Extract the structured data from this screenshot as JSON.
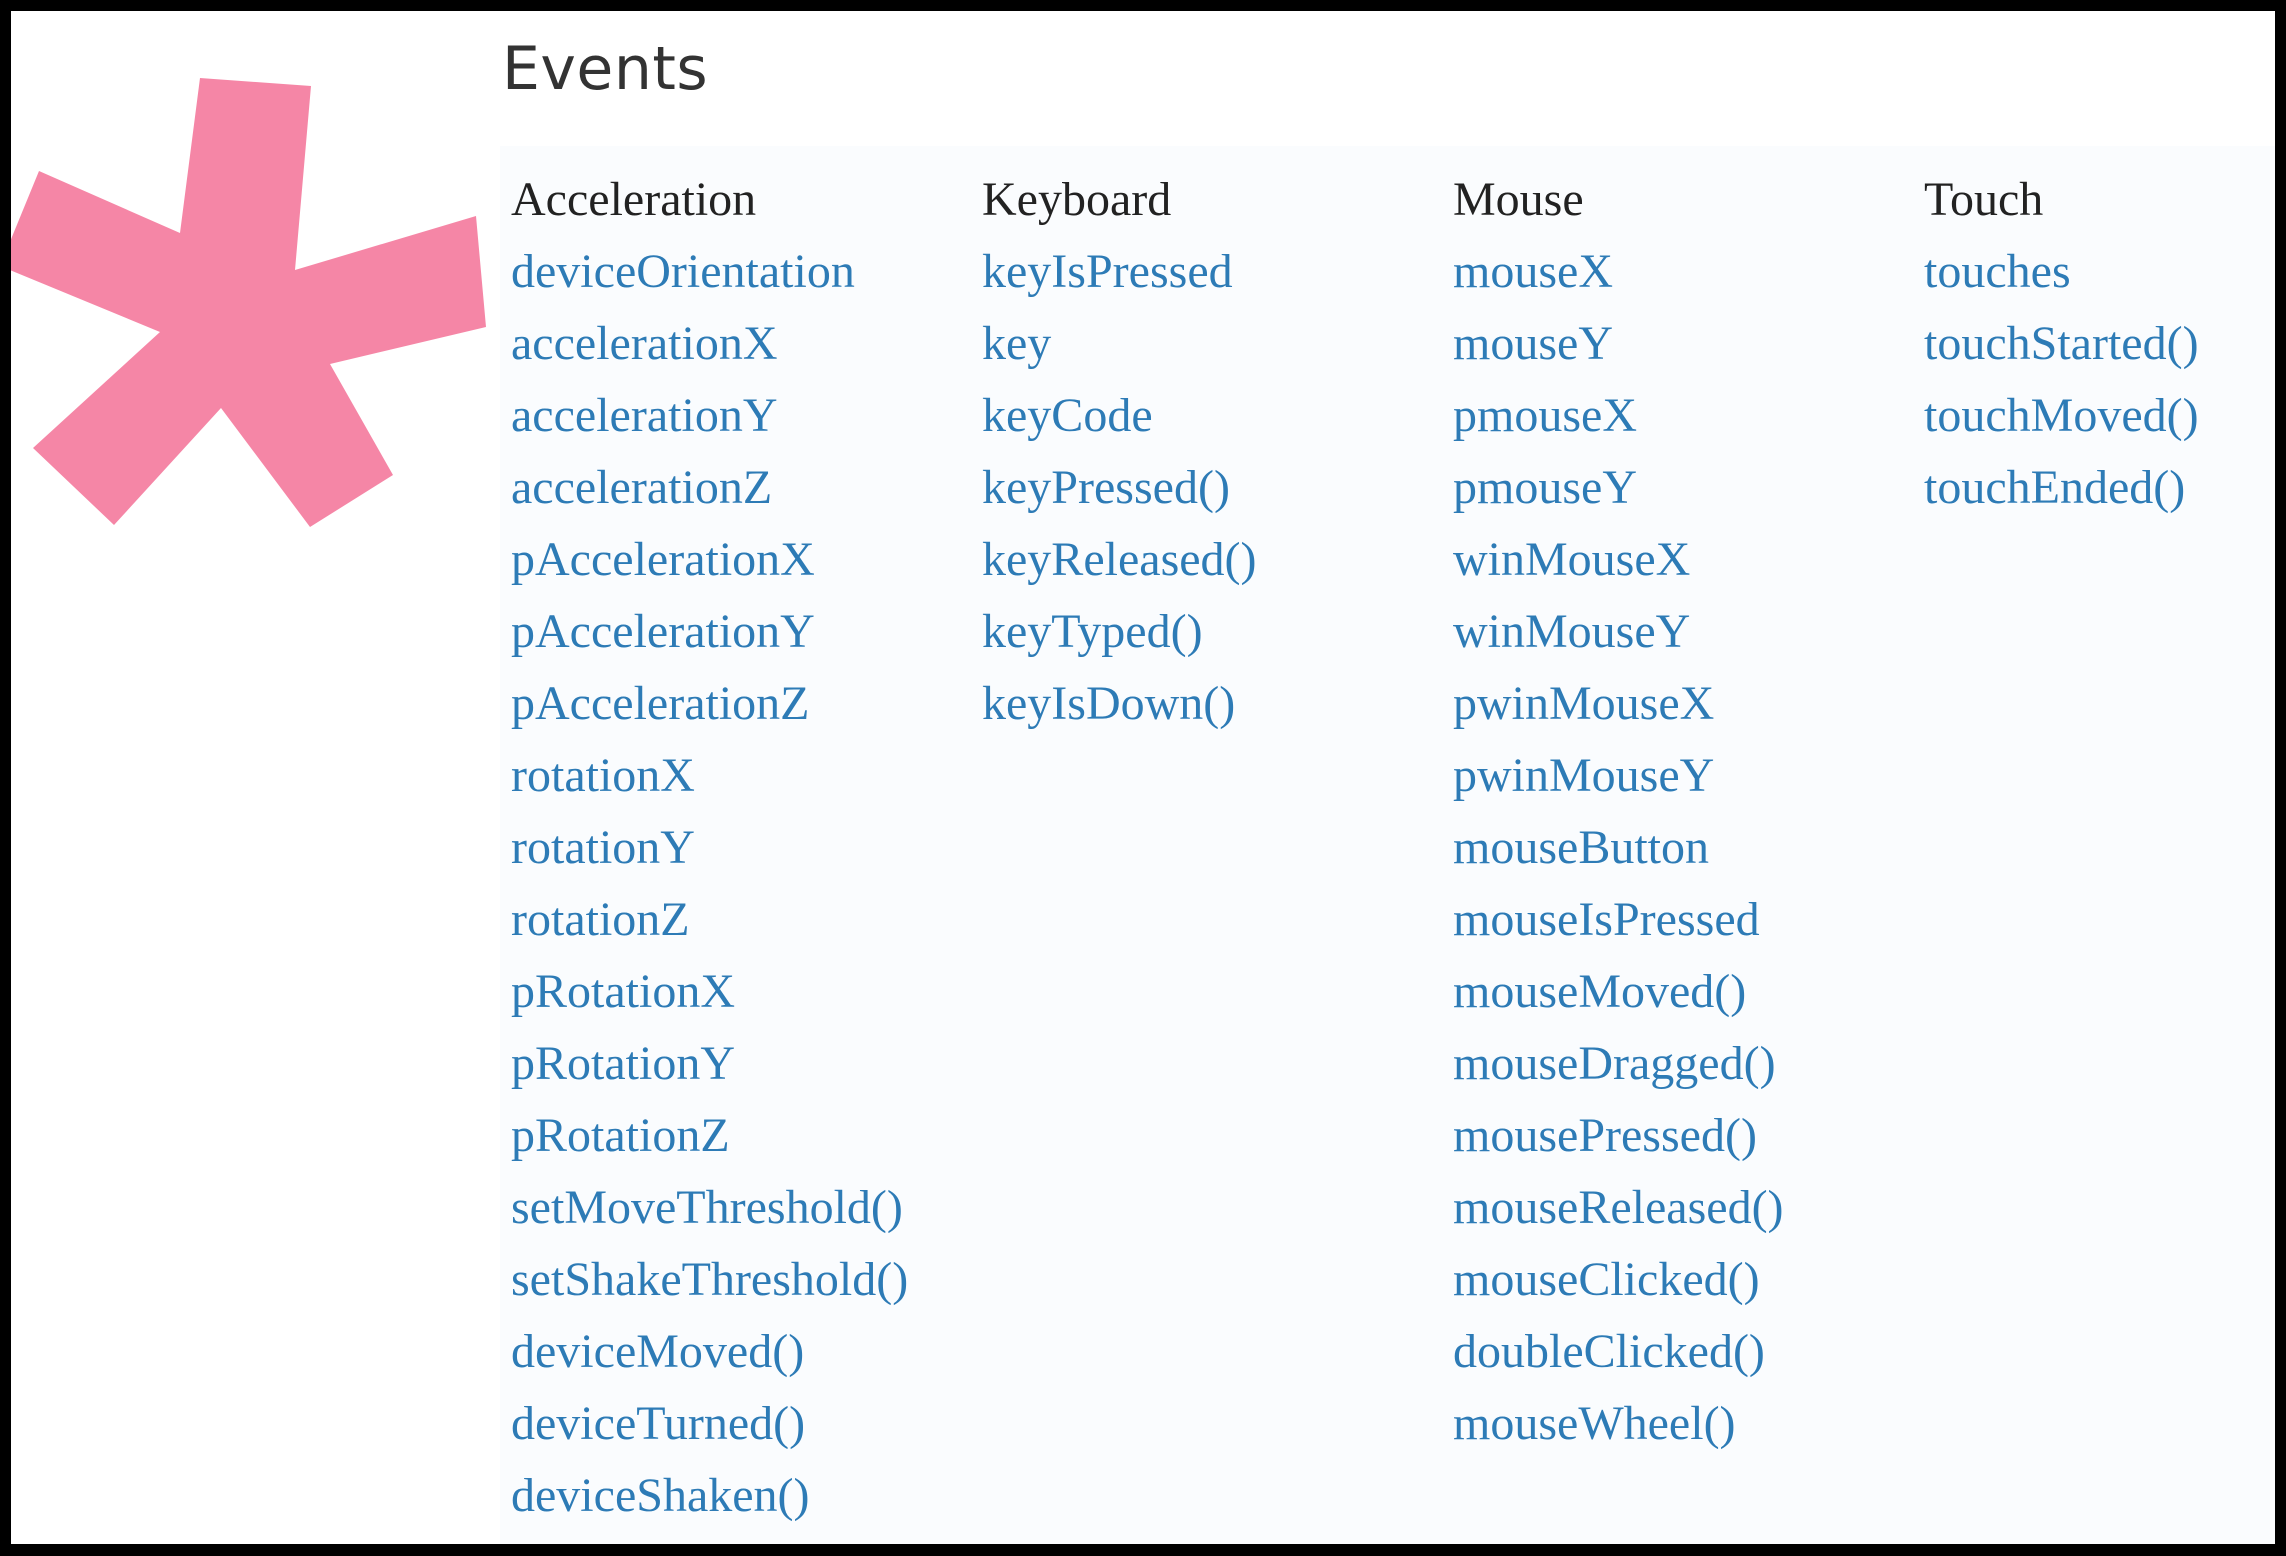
{
  "section": {
    "title": "Events"
  },
  "colors": {
    "accent_asterisk": "#ED225D",
    "link": "#2D7BB6",
    "heading": "#222222",
    "panel_background": "#FAFCFE"
  },
  "decoration": {
    "icon": "asterisk-icon"
  },
  "columns": [
    {
      "heading": "Acceleration",
      "items": [
        "deviceOrientation",
        "accelerationX",
        "accelerationY",
        "accelerationZ",
        "pAccelerationX",
        "pAccelerationY",
        "pAccelerationZ",
        "rotationX",
        "rotationY",
        "rotationZ",
        "pRotationX",
        "pRotationY",
        "pRotationZ",
        "setMoveThreshold()",
        "setShakeThreshold()",
        "deviceMoved()",
        "deviceTurned()",
        "deviceShaken()"
      ]
    },
    {
      "heading": "Keyboard",
      "items": [
        "keyIsPressed",
        "key",
        "keyCode",
        "keyPressed()",
        "keyReleased()",
        "keyTyped()",
        "keyIsDown()"
      ]
    },
    {
      "heading": "Mouse",
      "items": [
        "mouseX",
        "mouseY",
        "pmouseX",
        "pmouseY",
        "winMouseX",
        "winMouseY",
        "pwinMouseX",
        "pwinMouseY",
        "mouseButton",
        "mouseIsPressed",
        "mouseMoved()",
        "mouseDragged()",
        "mousePressed()",
        "mouseReleased()",
        "mouseClicked()",
        "doubleClicked()",
        "mouseWheel()"
      ]
    },
    {
      "heading": "Touch",
      "items": [
        "touches",
        "touchStarted()",
        "touchMoved()",
        "touchEnded()"
      ]
    }
  ]
}
